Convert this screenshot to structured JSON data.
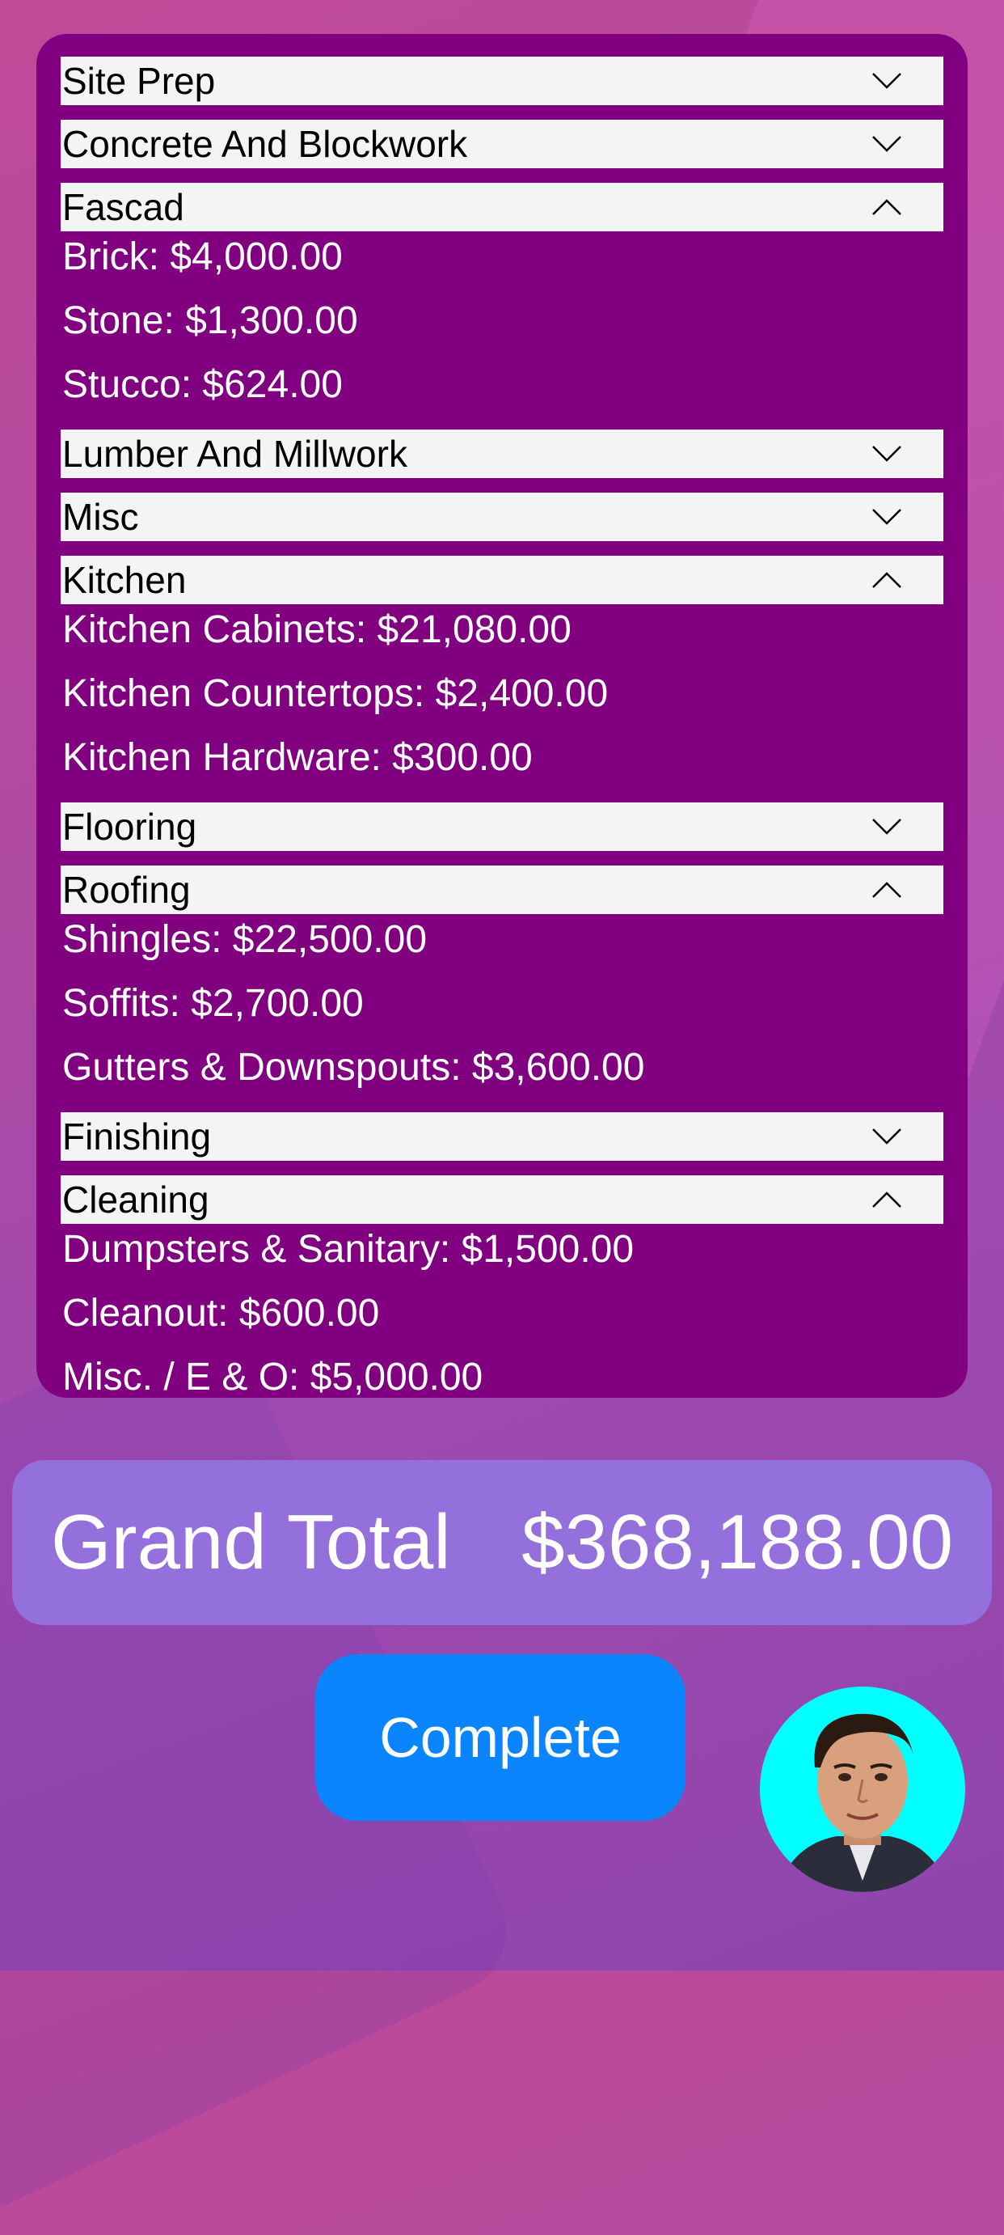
{
  "sections": [
    {
      "title": "Site Prep",
      "open": false,
      "items": []
    },
    {
      "title": "Concrete And Blockwork",
      "open": false,
      "items": []
    },
    {
      "title": "Fascad",
      "open": true,
      "items": [
        "Brick: $4,000.00",
        "Stone: $1,300.00",
        "Stucco: $624.00"
      ]
    },
    {
      "title": "Lumber And Millwork",
      "open": false,
      "items": []
    },
    {
      "title": "Misc",
      "open": false,
      "items": []
    },
    {
      "title": "Kitchen",
      "open": true,
      "items": [
        "Kitchen Cabinets: $21,080.00",
        "Kitchen Countertops: $2,400.00",
        "Kitchen Hardware: $300.00"
      ]
    },
    {
      "title": "Flooring",
      "open": false,
      "items": []
    },
    {
      "title": "Roofing",
      "open": true,
      "items": [
        "Shingles: $22,500.00",
        "Soffits: $2,700.00",
        "Gutters & Downspouts: $3,600.00"
      ]
    },
    {
      "title": "Finishing",
      "open": false,
      "items": []
    },
    {
      "title": "Cleaning",
      "open": true,
      "items": [
        "Dumpsters & Sanitary: $1,500.00",
        "Cleanout: $600.00",
        "Misc. / E & O: $5,000.00"
      ]
    }
  ],
  "total": {
    "label": "Grand Total",
    "value": "$368,188.00"
  },
  "complete_label": "Complete",
  "colors": {
    "panel": "#800080",
    "header": "#f4f4f4",
    "total_bg": "#9370db",
    "button": "#0a84ff",
    "avatar_bg": "#00ffff"
  }
}
